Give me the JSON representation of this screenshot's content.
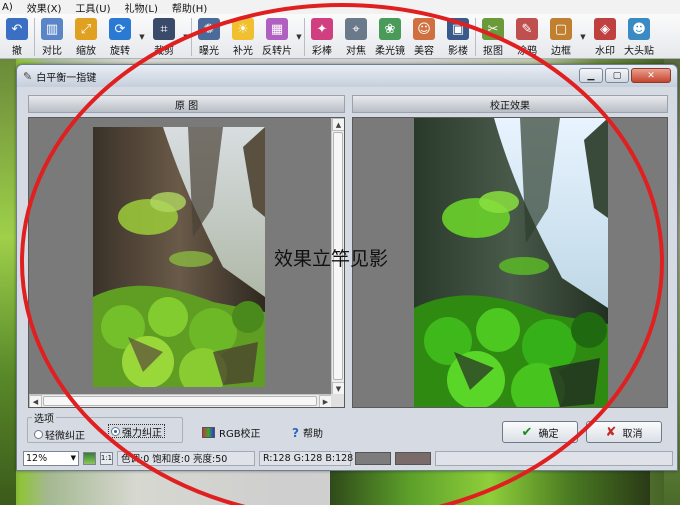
{
  "menubar": {
    "items": [
      "A)",
      "效果(X)",
      "工具(U)",
      "礼物(L)",
      "帮助(H)"
    ]
  },
  "toolbar": {
    "items": [
      {
        "label": "撤",
        "icon": "undo-icon",
        "color": "#3a6fc4"
      },
      {
        "label": "对比",
        "icon": "compare-icon",
        "color": "#5a86c9"
      },
      {
        "label": "缩放",
        "icon": "resize-icon",
        "color": "#e0a020"
      },
      {
        "label": "旋转",
        "icon": "rotate-icon",
        "color": "#2a7ad4"
      },
      {
        "label": "裁剪",
        "icon": "crop-icon",
        "color": "#3a4a6a"
      },
      {
        "label": "曝光",
        "icon": "exposure-icon",
        "color": "#4a6a9a"
      },
      {
        "label": "补光",
        "icon": "fill-light-icon",
        "color": "#f0c030"
      },
      {
        "label": "反转片",
        "icon": "film-icon",
        "color": "#b060c0"
      },
      {
        "label": "彩棒",
        "icon": "color-wand-icon",
        "color": "#d04080"
      },
      {
        "label": "对焦",
        "icon": "focus-icon",
        "color": "#6a7a8a"
      },
      {
        "label": "柔光镜",
        "icon": "soft-light-icon",
        "color": "#4a9a5a"
      },
      {
        "label": "美容",
        "icon": "beauty-icon",
        "color": "#d07040"
      },
      {
        "label": "影楼",
        "icon": "studio-icon",
        "color": "#3a5a8a"
      },
      {
        "label": "抠图",
        "icon": "cutout-icon",
        "color": "#6a9a3a"
      },
      {
        "label": "涂鸦",
        "icon": "doodle-icon",
        "color": "#c05050"
      },
      {
        "label": "边框",
        "icon": "border-icon",
        "color": "#c08030"
      },
      {
        "label": "水印",
        "icon": "watermark-icon",
        "color": "#c04040"
      },
      {
        "label": "大头贴",
        "icon": "sticker-icon",
        "color": "#3a8ac4"
      }
    ]
  },
  "dialog": {
    "title": "白平衡一指键",
    "left_panel_title": "原 图",
    "right_panel_title": "校正效果",
    "options": {
      "legend": "选项",
      "light_label": "轻微纠正",
      "strong_label": "强力纠正",
      "selected": "strong"
    },
    "rgb_label": "RGB校正",
    "help_label": "帮助",
    "ok_label": "确定",
    "cancel_label": "取消",
    "status": {
      "zoom": "12%",
      "fit_label": "1:1",
      "params": "色调:0 饱和度:0 亮度:50",
      "rgb": "R:128 G:128 B:128",
      "swatch_left": "#7c7c7c",
      "swatch_right": "#7a6a6a"
    }
  },
  "overlay_text": "效果立竿见影",
  "colors": {
    "annotation_red": "#e02020"
  }
}
